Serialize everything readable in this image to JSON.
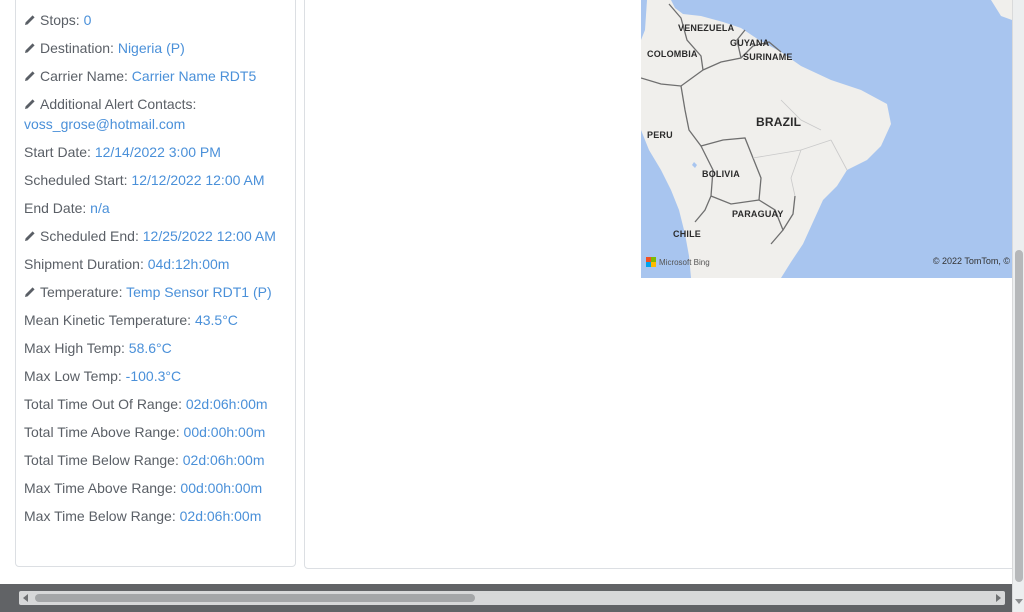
{
  "details": {
    "stops": {
      "label": "Stops:",
      "value": "0"
    },
    "destination": {
      "label": "Destination:",
      "value": "Nigeria (P)"
    },
    "carrier_name": {
      "label": "Carrier Name:",
      "value": "Carrier Name RDT5"
    },
    "additional_alert_contacts": {
      "label": "Additional Alert Contacts:",
      "value": "voss_grose@hotmail.com"
    },
    "start_date": {
      "label": "Start Date:",
      "value": "12/14/2022 3:00 PM"
    },
    "scheduled_start": {
      "label": "Scheduled Start:",
      "value": "12/12/2022 12:00 AM"
    },
    "end_date": {
      "label": "End Date:",
      "value": "n/a"
    },
    "scheduled_end": {
      "label": "Scheduled End:",
      "value": "12/25/2022 12:00 AM"
    },
    "shipment_duration": {
      "label": "Shipment Duration:",
      "value": "04d:12h:00m"
    },
    "temperature": {
      "label": "Temperature:",
      "value": "Temp Sensor RDT1 (P)"
    },
    "mean_kinetic_temperature": {
      "label": "Mean Kinetic Temperature:",
      "value": "43.5°C"
    },
    "max_high_temp": {
      "label": "Max High Temp:",
      "value": "58.6°C"
    },
    "max_low_temp": {
      "label": "Max Low Temp:",
      "value": "-100.3°C"
    },
    "total_time_out_of_range": {
      "label": "Total Time Out Of Range:",
      "value": "02d:06h:00m"
    },
    "total_time_above_range": {
      "label": "Total Time Above Range:",
      "value": "00d:00h:00m"
    },
    "total_time_below_range": {
      "label": "Total Time Below Range:",
      "value": "02d:06h:00m"
    },
    "max_time_above_range": {
      "label": "Max Time Above Range:",
      "value": "00d:00h:00m"
    },
    "max_time_below_range": {
      "label": "Max Time Below Range:",
      "value": "02d:06h:00m"
    }
  },
  "map": {
    "labels": {
      "venezuela": "VENEZUELA",
      "guyana": "GUYANA",
      "colombia": "COLOMBIA",
      "suriname": "SURINAME",
      "brazil": "BRAZIL",
      "peru": "PERU",
      "bolivia": "BOLIVIA",
      "paraguay": "PARAGUAY",
      "chile": "CHILE"
    },
    "attribution": "© 2022 TomTom, ©",
    "provider": "Microsoft Bing"
  },
  "colors": {
    "value_text": "#4a90d9",
    "label_text": "#5a5f66",
    "ocean": "#a8c5ef",
    "land": "#f0efec"
  },
  "icons": {
    "edit": "pencil-icon"
  }
}
